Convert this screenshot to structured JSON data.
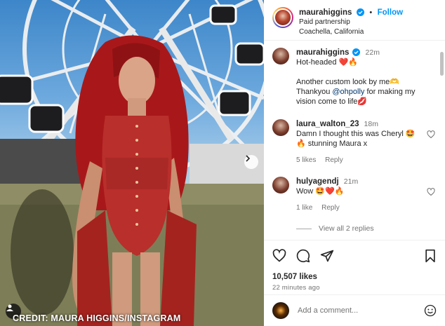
{
  "photo": {
    "credit": "CREDIT: MAURA HIGGINS/INSTAGRAM",
    "next_icon": "chevron-right-icon",
    "tag_icon": "person-tag-icon"
  },
  "header": {
    "username": "maurahiggins",
    "verified_icon": "verified-badge-icon",
    "separator": "•",
    "follow_label": "Follow",
    "paid_partnership": "Paid partnership",
    "location": "Coachella, California"
  },
  "caption": {
    "username": "maurahiggins",
    "time": "22m",
    "line1": "Hot-headed ❤️🔥",
    "line2_prefix": "Another custom look by me🫶 Thankyou",
    "mention": "@ohpolly",
    "line2_suffix": "for making my vision come to life💋"
  },
  "comments": [
    {
      "username": "laura_walton_23",
      "time": "18m",
      "text": "Damn I thought this was Cheryl 🤩 🔥 stunning Maura x",
      "likes": "5 likes",
      "reply": "Reply"
    },
    {
      "username": "hulyagendj",
      "time": "21m",
      "text": "Wow 🤩❤️🔥",
      "likes": "1 like",
      "reply": "Reply"
    }
  ],
  "view_replies": "View all 2 replies",
  "actions": {
    "like_icon": "heart-icon",
    "comment_icon": "comment-icon",
    "share_icon": "share-icon",
    "save_icon": "bookmark-icon"
  },
  "likes_count": "10,507 likes",
  "posted_ago": "22 minutes ago",
  "add_comment": {
    "placeholder": "Add a comment...",
    "emoji_icon": "emoji-icon"
  },
  "colors": {
    "accent": "#0095f6",
    "text": "#262626",
    "muted": "#737373",
    "dress_red": "#b92f2b"
  }
}
